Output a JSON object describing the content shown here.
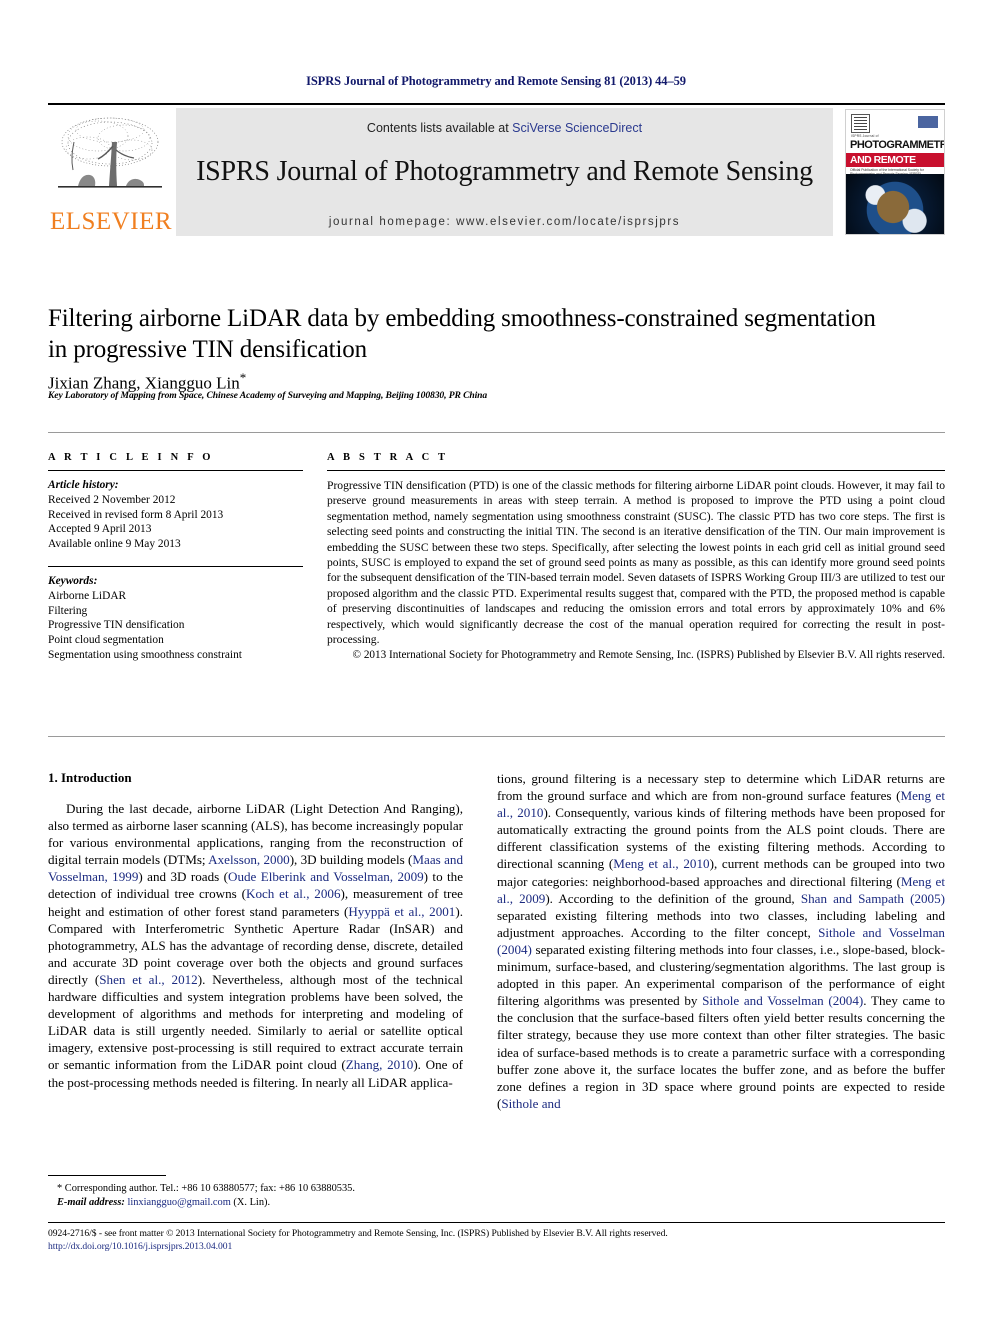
{
  "running_head": "ISPRS Journal of Photogrammetry and Remote Sensing 81 (2013) 44–59",
  "masthead": {
    "contents_prefix": "Contents lists available at ",
    "sciencedirect": "SciVerse ScienceDirect",
    "journal_name": "ISPRS Journal of Photogrammetry and Remote Sensing",
    "homepage": "journal homepage: www.elsevier.com/locate/isprsjprs",
    "publisher_wordmark": "ELSEVIER",
    "cover": {
      "eyebrow": "ISPRS Journal of",
      "title_line1": "PHOTOGRAMMETRY",
      "title_line2": "AND REMOTE SENSING",
      "subtitle": "Official Publication of the International Society for Photogrammetry and Remote Sensing (ISPRS)"
    }
  },
  "article": {
    "title": "Filtering airborne LiDAR data by embedding smoothness-constrained segmentation in progressive TIN densification",
    "authors": "Jixian Zhang, Xiangguo Lin",
    "corresponding_marker": "*",
    "affiliation": "Key Laboratory of Mapping from Space, Chinese Academy of Surveying and Mapping, Beijing 100830, PR China"
  },
  "article_info": {
    "heading": "A R T I C L E   I N F O",
    "history_label": "Article history:",
    "history": [
      "Received 2 November 2012",
      "Received in revised form 8 April 2013",
      "Accepted 9 April 2013",
      "Available online 9 May 2013"
    ],
    "keywords_label": "Keywords:",
    "keywords": [
      "Airborne LiDAR",
      "Filtering",
      "Progressive TIN densification",
      "Point cloud segmentation",
      "Segmentation using smoothness constraint"
    ]
  },
  "abstract": {
    "heading": "A B S T R A C T",
    "body": "Progressive TIN densification (PTD) is one of the classic methods for filtering airborne LiDAR point clouds. However, it may fail to preserve ground measurements in areas with steep terrain. A method is proposed to improve the PTD using a point cloud segmentation method, namely segmentation using smoothness constraint (SUSC). The classic PTD has two core steps. The first is selecting seed points and constructing the initial TIN. The second is an iterative densification of the TIN. Our main improvement is embedding the SUSC between these two steps. Specifically, after selecting the lowest points in each grid cell as initial ground seed points, SUSC is employed to expand the set of ground seed points as many as possible, as this can identify more ground seed points for the subsequent densification of the TIN-based terrain model. Seven datasets of ISPRS Working Group III/3 are utilized to test our proposed algorithm and the classic PTD. Experimental results suggest that, compared with the PTD, the proposed method is capable of preserving discontinuities of landscapes and reducing the omission errors and total errors by approximately 10% and 6% respectively, which would significantly decrease the cost of the manual operation required for correcting the result in post-processing.",
    "copyright": "© 2013 International Society for Photogrammetry and Remote Sensing, Inc. (ISPRS) Published by Elsevier B.V. All rights reserved."
  },
  "body": {
    "section_heading": "1. Introduction",
    "left_para_1_html": "During the last decade, airborne LiDAR (Light Detection And Ranging), also termed as airborne laser scanning (ALS), has become increasingly popular for various environmental applications, ranging from the reconstruction of digital terrain models (DTMs; <span class=\"ref\">Axelsson, 2000</span>), 3D building models (<span class=\"ref\">Maas and Vosselman, 1999</span>) and 3D roads (<span class=\"ref\">Oude Elberink and Vosselman, 2009</span>) to the detection of individual tree crowns (<span class=\"ref\">Koch et al., 2006</span>), measurement of tree height and estimation of other forest stand parameters (<span class=\"ref\">Hyyppä et al., 2001</span>). Compared with Interferometric Synthetic Aperture Radar (InSAR) and photogrammetry, ALS has the advantage of recording dense, discrete, detailed and accurate 3D point coverage over both the objects and ground surfaces directly (<span class=\"ref\">Shen et al., 2012</span>). Nevertheless, although most of the technical hardware difficulties and system integration problems have been solved, the development of algorithms and methods for interpreting and modeling of LiDAR data is still urgently needed. Similarly to aerial or satellite optical imagery, extensive post-processing is still required to extract accurate terrain or semantic information from the LiDAR point cloud (<span class=\"ref\">Zhang, 2010</span>). One of the post-processing methods needed is filtering. In nearly all LiDAR applica-",
    "right_para_1_html": "tions, ground filtering is a necessary step to determine which LiDAR returns are from the ground surface and which are from non-ground surface features (<span class=\"ref\">Meng et al., 2010</span>). Consequently, various kinds of filtering methods have been proposed for automatically extracting the ground points from the ALS point clouds. There are different classification systems of the existing filtering methods. According to directional scanning (<span class=\"ref\">Meng et al., 2010</span>), current methods can be grouped into two major categories: neighborhood-based approaches and directional filtering (<span class=\"ref\">Meng et al., 2009</span>). According to the definition of the ground, <span class=\"ref\">Shan and Sampath (2005)</span> separated existing filtering methods into two classes, including labeling and adjustment approaches. According to the filter concept, <span class=\"ref\">Sithole and Vosselman (2004)</span> separated existing filtering methods into four classes, i.e., slope-based, block-minimum, surface-based, and clustering/segmentation algorithms. The last group is adopted in this paper. An experimental comparison of the performance of eight filtering algorithms was presented by <span class=\"ref\">Sithole and Vosselman (2004)</span>. They came to the conclusion that the surface-based filters often yield better results concerning the filter strategy, because they use more context than other filter strategies. The basic idea of surface-based methods is to create a parametric surface with a corresponding buffer zone above it, the surface locates the buffer zone, and as before the buffer zone defines a region in 3D space where ground points are expected to reside (<span class=\"ref\">Sithole and</span>"
  },
  "footnote": {
    "line1": "* Corresponding author. Tel.: +86 10 63880577; fax: +86 10 63880535.",
    "email_label": "E-mail address:",
    "email": "linxiangguo@gmail.com",
    "email_suffix": "(X. Lin)."
  },
  "page_footer": {
    "line1": "0924-2716/$ - see front matter © 2013 International Society for Photogrammetry and Remote Sensing, Inc. (ISPRS) Published by Elsevier B.V. All rights reserved.",
    "doi": "http://dx.doi.org/10.1016/j.isprsjprs.2013.04.001"
  },
  "colors": {
    "link_blue": "#1b2a80",
    "sciencedirect_blue": "#2b3a8f",
    "elsevier_orange": "#f07f20",
    "running_head_navy": "#12196b",
    "masthead_gray": "#e6e6e6",
    "cover_red": "#c8102e"
  }
}
